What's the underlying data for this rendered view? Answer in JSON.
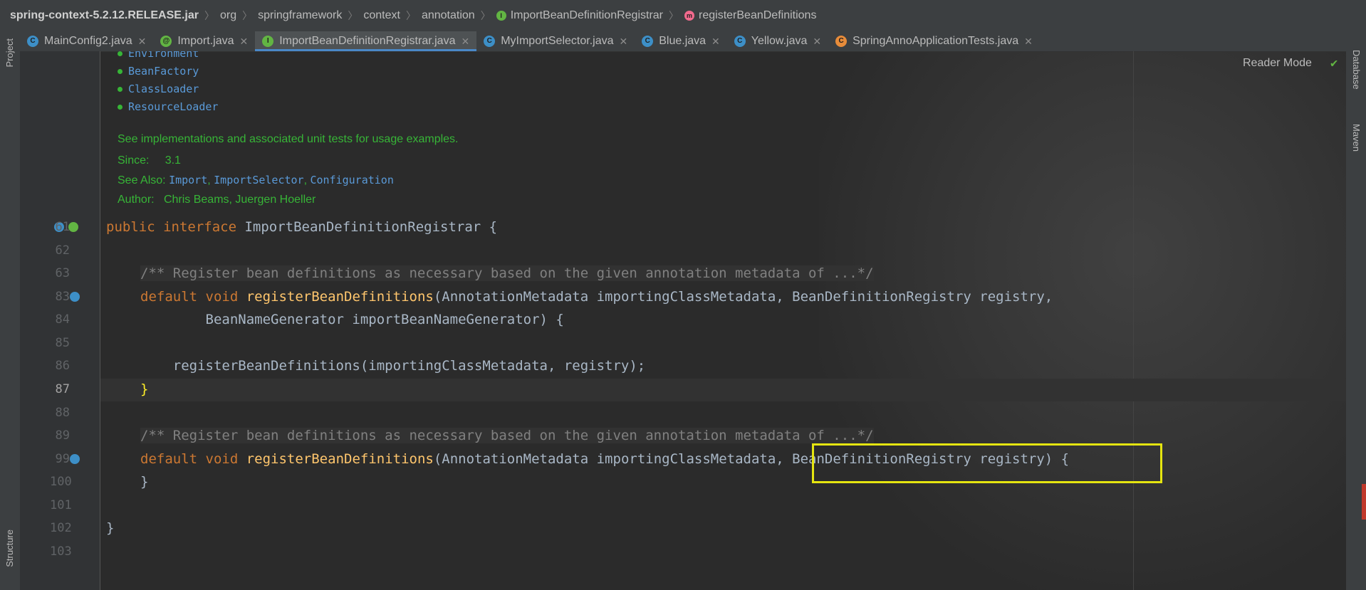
{
  "breadcrumb": {
    "jar": "spring-context-5.2.12.RELEASE.jar",
    "p1": "org",
    "p2": "springframework",
    "p3": "context",
    "p4": "annotation",
    "interface": "ImportBeanDefinitionRegistrar",
    "method": "registerBeanDefinitions"
  },
  "tabs": [
    {
      "label": "MainConfig2.java",
      "icon": "class-icon"
    },
    {
      "label": "Import.java",
      "icon": "annotation-icon"
    },
    {
      "label": "ImportBeanDefinitionRegistrar.java",
      "icon": "interface-icon",
      "active": true
    },
    {
      "label": "MyImportSelector.java",
      "icon": "class-icon"
    },
    {
      "label": "Blue.java",
      "icon": "class-icon"
    },
    {
      "label": "Yellow.java",
      "icon": "class-icon"
    },
    {
      "label": "SpringAnnoApplicationTests.java",
      "icon": "test-class-icon"
    }
  ],
  "sidebar": {
    "left_top": "Project",
    "left_bottom": "Structure",
    "right_top": "Database",
    "right_mid": "Maven"
  },
  "reader_mode": "Reader Mode",
  "doc": {
    "items": [
      "Environment",
      "BeanFactory",
      "ClassLoader",
      "ResourceLoader"
    ],
    "see_impl": "See implementations and associated unit tests for usage examples.",
    "since_label": "Since:",
    "since_value": "3.1",
    "see_also_label": "See Also:",
    "see_also": [
      "Import",
      "ImportSelector",
      "Configuration"
    ],
    "author_label": "Author:",
    "author_value": "Chris Beams, Juergen Hoeller"
  },
  "lines": {
    "n61": "61",
    "n62": "62",
    "n63": "63",
    "n83": "83",
    "n84": "84",
    "n85": "85",
    "n86": "86",
    "n87": "87",
    "n88": "88",
    "n89": "89",
    "n99": "99",
    "n100": "100",
    "n101": "101",
    "n102": "102",
    "n103": "103"
  },
  "code": {
    "l61_kw": "public interface",
    "l61_rest": " ImportBeanDefinitionRegistrar {",
    "l63_comment": "/** Register bean definitions as necessary based on the given annotation metadata of ...*/",
    "l83_kw": "default void",
    "l83_fn": "registerBeanDefinitions",
    "l83_rest": "(AnnotationMetadata importingClassMetadata, BeanDefinitionRegistry registry,",
    "l84": "        BeanNameGenerator importBeanNameGenerator) {",
    "l86": "    registerBeanDefinitions(importingClassMetadata, registry);",
    "l87": "}",
    "l89_comment": "/** Register bean definitions as necessary based on the given annotation metadata of ...*/",
    "l99_kw": "default void",
    "l99_fn": "registerBeanDefinitions",
    "l99_rest": "(AnnotationMetadata importingClassMetadata, BeanDefinitionRegistry registry) {",
    "l100": "}",
    "l102": "}"
  },
  "colors": {
    "keyword": "#cc7832",
    "method": "#ffc66d",
    "doc_text": "#37b537",
    "doc_link": "#5a9ad8",
    "highlight_box": "#e5e510"
  }
}
